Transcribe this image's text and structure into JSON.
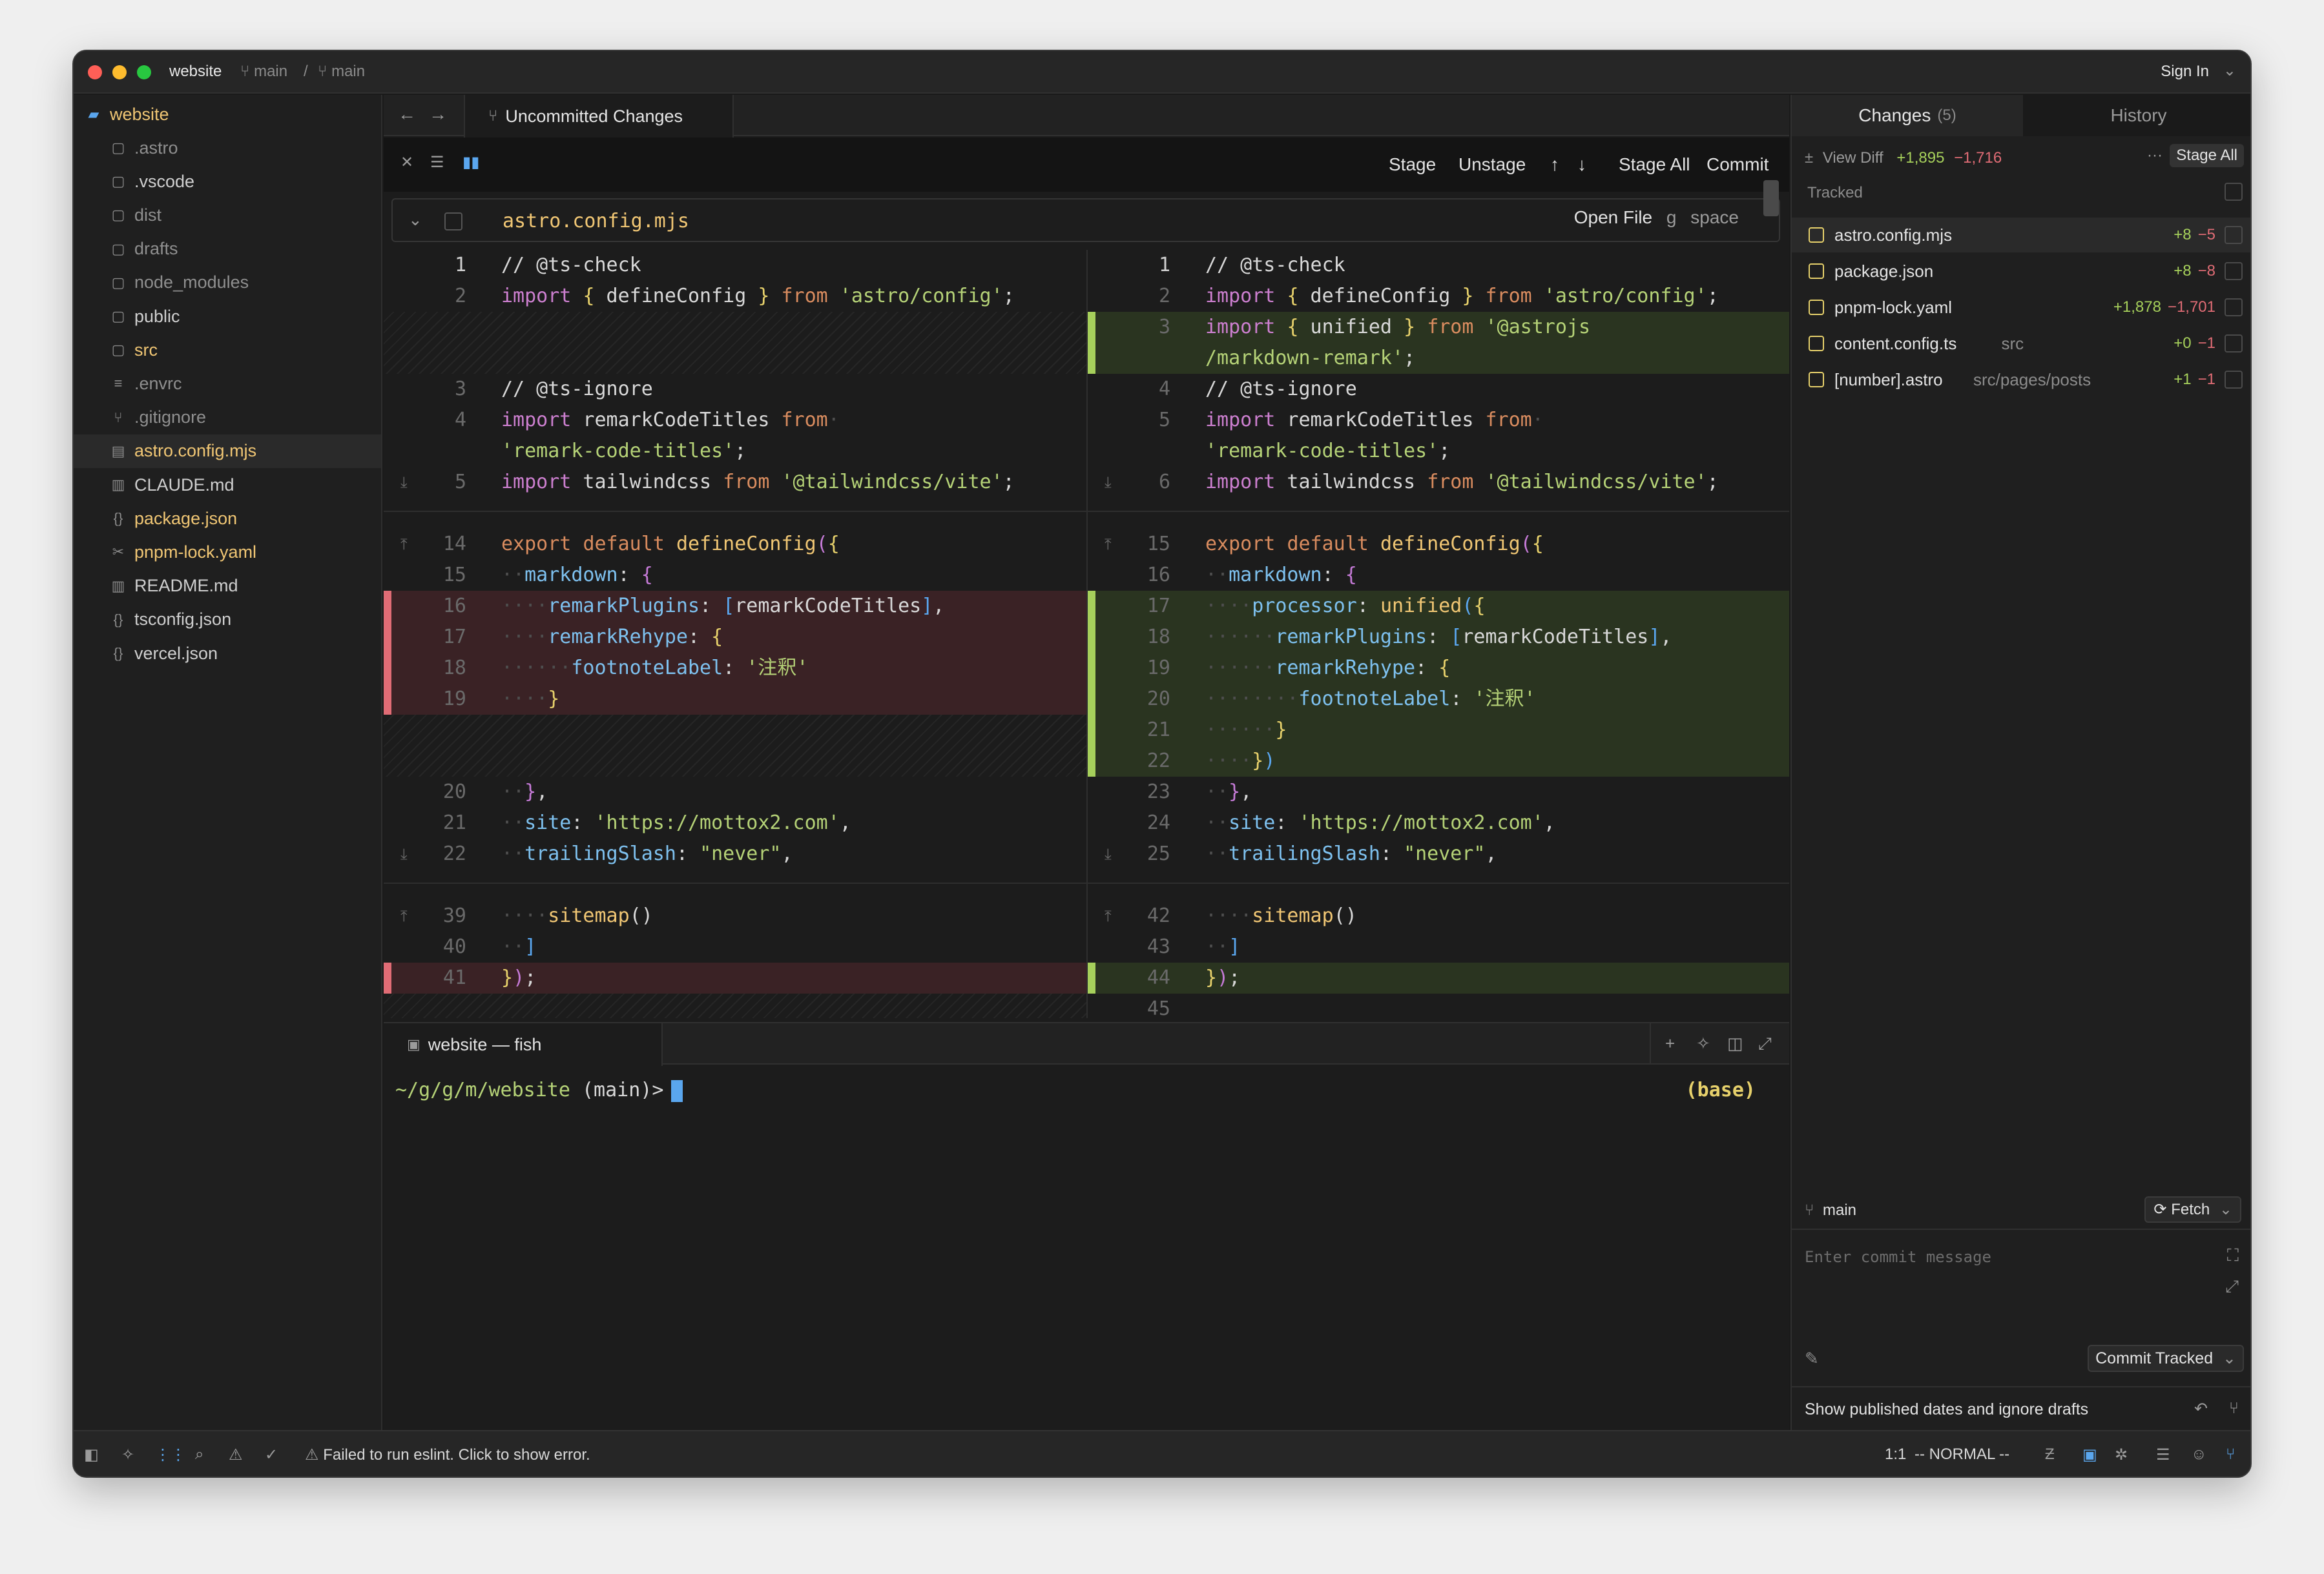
{
  "window": {
    "project": "website",
    "branch_a": "main",
    "branch_b": "main",
    "sign_in": "Sign In"
  },
  "sidebar": {
    "root": "website",
    "items": [
      {
        "label": ".astro",
        "icon": "folder-icon",
        "color": "#8f8f8f"
      },
      {
        "label": ".vscode",
        "icon": "folder-icon",
        "color": "#cfcfcf"
      },
      {
        "label": "dist",
        "icon": "folder-icon",
        "color": "#8f8f8f"
      },
      {
        "label": "drafts",
        "icon": "folder-icon",
        "color": "#8f8f8f"
      },
      {
        "label": "node_modules",
        "icon": "folder-icon",
        "color": "#8f8f8f"
      },
      {
        "label": "public",
        "icon": "folder-icon",
        "color": "#cfcfcf"
      },
      {
        "label": "src",
        "icon": "folder-icon",
        "color": "#f0c674"
      },
      {
        "label": ".envrc",
        "icon": "lines-icon",
        "color": "#8f8f8f"
      },
      {
        "label": ".gitignore",
        "icon": "git-icon",
        "color": "#8f8f8f"
      },
      {
        "label": "astro.config.mjs",
        "icon": "config-file-icon",
        "color": "#f0c674"
      },
      {
        "label": "CLAUDE.md",
        "icon": "book-icon",
        "color": "#cfcfcf"
      },
      {
        "label": "package.json",
        "icon": "braces-icon",
        "color": "#f0c674"
      },
      {
        "label": "pnpm-lock.yaml",
        "icon": "yaml-icon",
        "color": "#f0c674"
      },
      {
        "label": "README.md",
        "icon": "book-icon",
        "color": "#cfcfcf"
      },
      {
        "label": "tsconfig.json",
        "icon": "braces-icon",
        "color": "#cfcfcf"
      },
      {
        "label": "vercel.json",
        "icon": "braces-icon",
        "color": "#cfcfcf"
      }
    ]
  },
  "editor": {
    "tab_label": "Uncommitted Changes",
    "toolbar": {
      "stage": "Stage",
      "unstage": "Unstage",
      "stage_all": "Stage All",
      "commit": "Commit"
    },
    "file_header": {
      "file_name": "astro.config.mjs",
      "open_file": "Open File",
      "key_g": "g",
      "key_space": "space"
    }
  },
  "terminal": {
    "tab_label": "website — fish",
    "prompt_path": "~/g/g/m/website",
    "prompt_branch": "(main)>",
    "env": "(base)"
  },
  "right_panel": {
    "tab_changes": "Changes",
    "changes_count": "(5)",
    "tab_history": "History",
    "view_diff": "View Diff",
    "total_added": "+1,895",
    "total_removed": "−1,716",
    "stage_all": "Stage All",
    "tracked_label": "Tracked",
    "files": [
      {
        "name": "astro.config.mjs",
        "path": "",
        "added": "+8",
        "removed": "−5"
      },
      {
        "name": "package.json",
        "path": "",
        "added": "+8",
        "removed": "−8"
      },
      {
        "name": "pnpm-lock.yaml",
        "path": "",
        "added": "+1,878",
        "removed": "−1,701"
      },
      {
        "name": "content.config.ts",
        "path": "src",
        "added": "+0",
        "removed": "−1"
      },
      {
        "name": "[number].astro",
        "path": "src/pages/posts",
        "added": "+1",
        "removed": "−1"
      }
    ],
    "branch": "main",
    "fetch": "Fetch",
    "commit_placeholder": "Enter commit message",
    "commit_button": "Commit Tracked",
    "last_commit": "Show published dates and ignore drafts"
  },
  "status_bar": {
    "error": "Failed to run eslint. Click to show error.",
    "position": "1:1",
    "mode": "-- NORMAL --"
  },
  "colors": {
    "added": "#a6d05b",
    "removed": "#e06c75",
    "accent": "#5aa6ee",
    "modified": "#f0c674"
  }
}
